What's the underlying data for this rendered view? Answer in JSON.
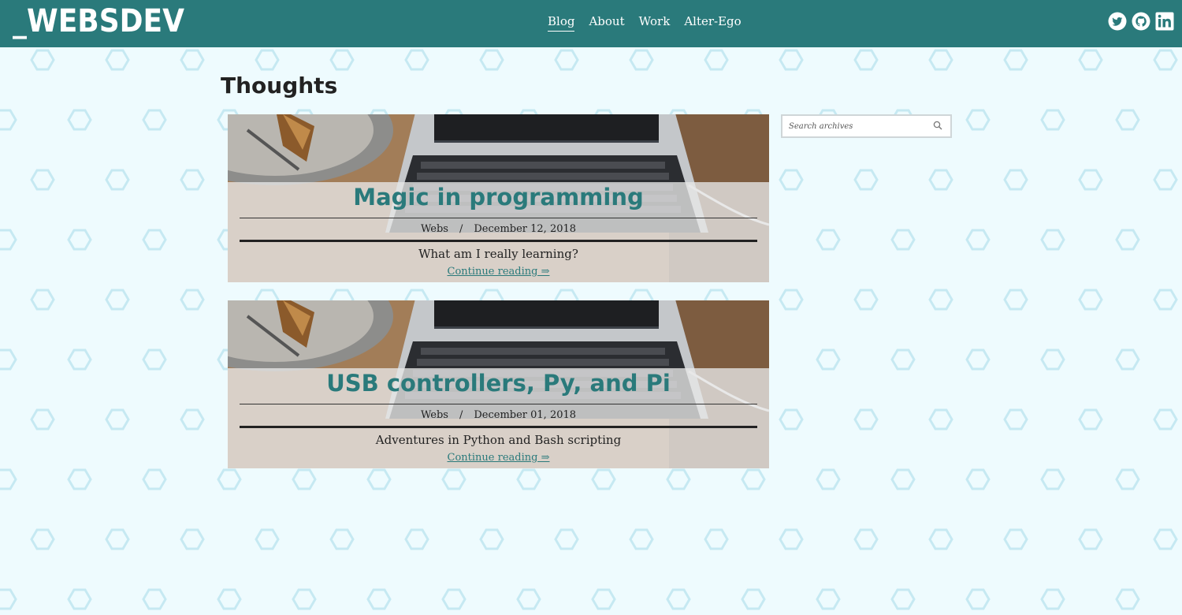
{
  "header": {
    "logo": "_WEBSDEV",
    "nav": [
      {
        "label": "Blog",
        "active": true
      },
      {
        "label": "About",
        "active": false
      },
      {
        "label": "Work",
        "active": false
      },
      {
        "label": "Alter-Ego",
        "active": false
      }
    ],
    "social_icons": [
      "twitter-icon",
      "github-icon",
      "linkedin-icon"
    ]
  },
  "page": {
    "title": "Thoughts"
  },
  "posts": [
    {
      "title": "Magic in programming",
      "author": "Webs",
      "separator": "/",
      "date": "December 12, 2018",
      "excerpt": "What am I really learning?",
      "link_label": "Continue reading ⇒"
    },
    {
      "title": "USB controllers, Py, and Pi",
      "author": "Webs",
      "separator": "/",
      "date": "December 01, 2018",
      "excerpt": "Adventures in Python and Bash scripting",
      "link_label": "Continue reading ⇒"
    }
  ],
  "sidebar": {
    "search": {
      "placeholder": "Search archives",
      "value": "",
      "icon": "search-icon"
    }
  },
  "colors": {
    "accent": "#2a7a7b",
    "background": "#eefbfe",
    "hex_pattern": "#c6e9f2"
  }
}
